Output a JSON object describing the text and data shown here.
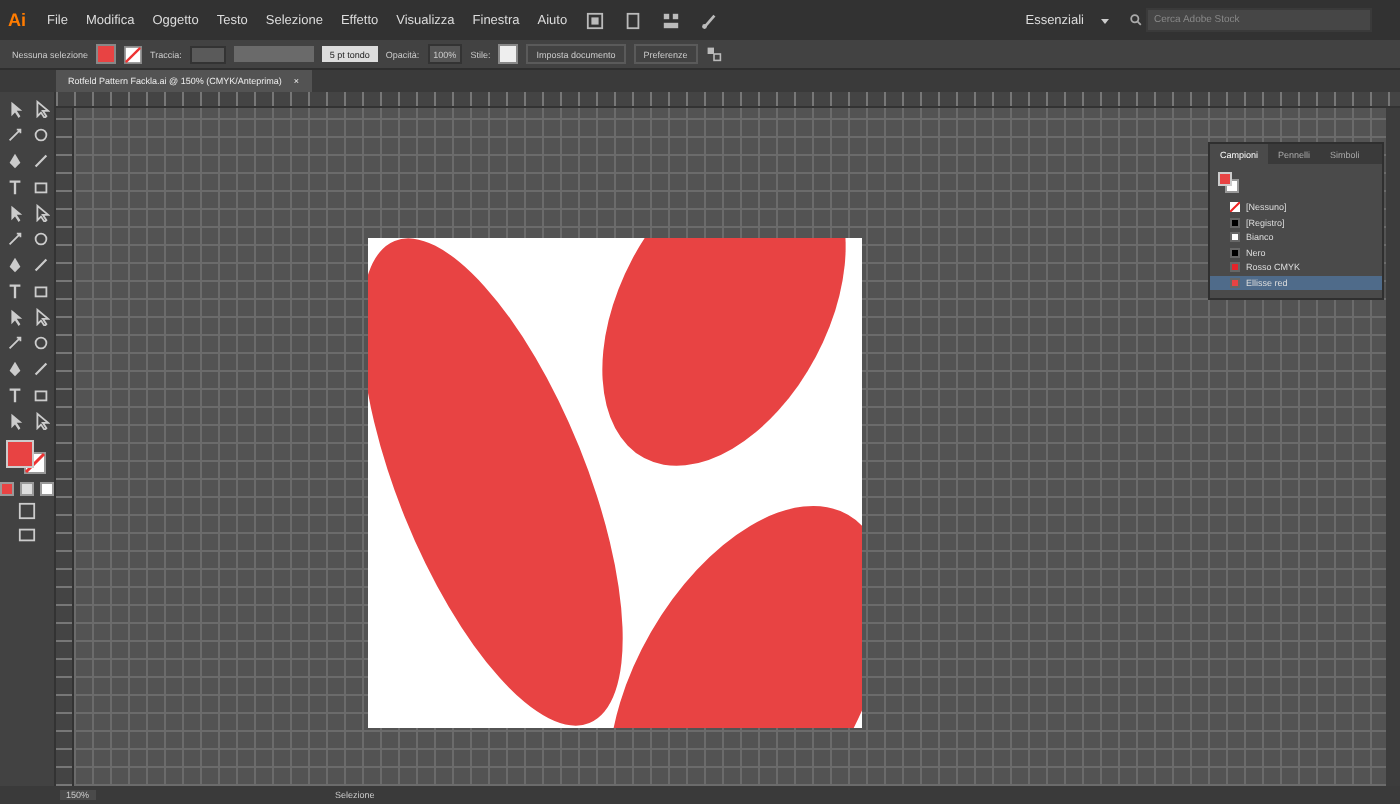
{
  "app": {
    "logo": "Ai",
    "menu": [
      "File",
      "Modifica",
      "Oggetto",
      "Testo",
      "Selezione",
      "Effetto",
      "Visualizza",
      "Finestra",
      "Aiuto"
    ],
    "workspace": "Essenziali",
    "search": {
      "placeholder": "Cerca Adobe Stock"
    }
  },
  "control_bar": {
    "selection": "Nessuna selezione",
    "stroke_label": "Traccia:",
    "brush": "5 pt tondo",
    "opacity_label": "Opacità:",
    "opacity": "100%",
    "style_label": "Stile:",
    "buttons": [
      "Imposta documento",
      "Preferenze"
    ]
  },
  "document_tab": {
    "title": "Rotfeld Pattern Fackla.ai @ 150% (CMYK/Anteprima)",
    "close": "×"
  },
  "swatches_panel": {
    "tabs": [
      {
        "label": "Campioni",
        "selected": true
      },
      {
        "label": "Pennelli",
        "selected": false
      },
      {
        "label": "Simboli",
        "selected": false
      }
    ],
    "swatches": [
      {
        "name": "[Nessuno]",
        "kind": "none",
        "selected": false
      },
      {
        "name": "[Registro]",
        "kind": "color",
        "color": "#000000",
        "selected": false
      },
      {
        "name": "Bianco",
        "kind": "color",
        "color": "#ffffff",
        "selected": false
      },
      {
        "name": "Nero",
        "kind": "color",
        "color": "#000000",
        "selected": false
      },
      {
        "name": "Rosso CMYK",
        "kind": "color",
        "color": "#e5242a",
        "selected": false
      },
      {
        "name": "Ellisse red",
        "kind": "color",
        "color": "#e84343",
        "selected": true
      }
    ]
  },
  "status_bar": {
    "zoom": "150%",
    "mode": "Selezione"
  }
}
